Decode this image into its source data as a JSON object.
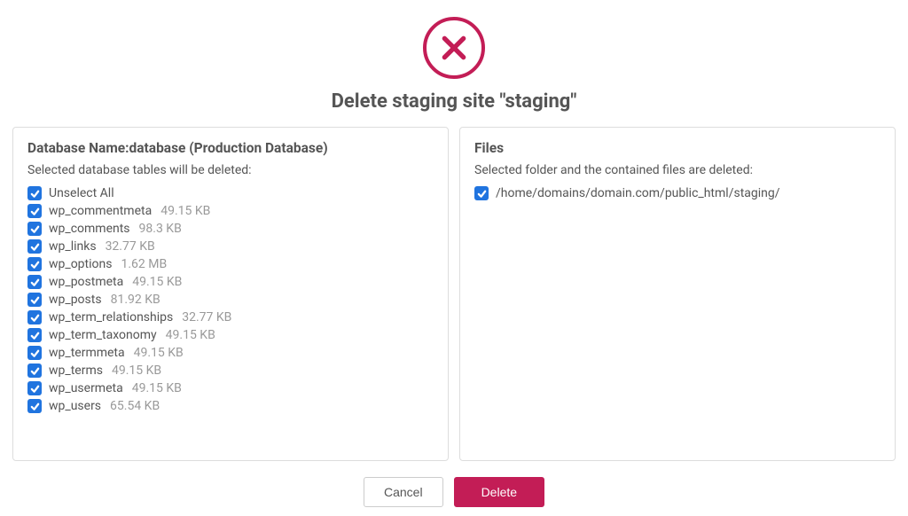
{
  "title": "Delete staging site \"staging\"",
  "db": {
    "heading": "Database Name:database (Production Database)",
    "subtitle": "Selected database tables will be deleted:",
    "unselect_label": "Unselect All",
    "tables": [
      {
        "name": "wp_commentmeta",
        "size": "49.15 KB"
      },
      {
        "name": "wp_comments",
        "size": "98.3 KB"
      },
      {
        "name": "wp_links",
        "size": "32.77 KB"
      },
      {
        "name": "wp_options",
        "size": "1.62 MB"
      },
      {
        "name": "wp_postmeta",
        "size": "49.15 KB"
      },
      {
        "name": "wp_posts",
        "size": "81.92 KB"
      },
      {
        "name": "wp_term_relationships",
        "size": "32.77 KB"
      },
      {
        "name": "wp_term_taxonomy",
        "size": "49.15 KB"
      },
      {
        "name": "wp_termmeta",
        "size": "49.15 KB"
      },
      {
        "name": "wp_terms",
        "size": "49.15 KB"
      },
      {
        "name": "wp_usermeta",
        "size": "49.15 KB"
      },
      {
        "name": "wp_users",
        "size": "65.54 KB"
      }
    ]
  },
  "files": {
    "heading": "Files",
    "subtitle": "Selected folder and the contained files are deleted:",
    "path": "/home/domains/domain.com/public_html/staging/"
  },
  "buttons": {
    "cancel": "Cancel",
    "delete": "Delete"
  },
  "colors": {
    "accent": "#c31d56",
    "checkbox": "#2074df"
  }
}
